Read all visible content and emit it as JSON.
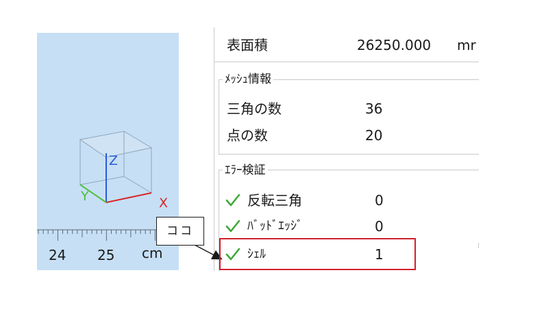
{
  "viewport": {
    "axes": {
      "x": "X",
      "y": "Y",
      "z": "Z"
    },
    "ruler": {
      "labels": [
        "24",
        "25"
      ],
      "unit": "cm"
    },
    "colors": {
      "background": "#c6dff5",
      "x_axis": "#d8262a",
      "y_axis": "#4fbf3d",
      "z_axis": "#2a5bd6"
    }
  },
  "properties": {
    "surface_area": {
      "label": "表面積",
      "value": "26250.000",
      "unit": "mr"
    },
    "mesh_info": {
      "title": "ﾒｯｼｭ情報",
      "triangles": {
        "label": "三角の数",
        "value": "36"
      },
      "points": {
        "label": "点の数",
        "value": "20"
      }
    },
    "error_check": {
      "title": "ｴﾗｰ検証",
      "items": [
        {
          "label": "反転三角",
          "value": "0",
          "icon": "check-icon"
        },
        {
          "label": "ﾊﾞｯﾄﾞｴｯｼﾞ",
          "value": "0",
          "icon": "check-icon"
        },
        {
          "label": "ｼｪﾙ",
          "value": "1",
          "icon": "check-icon"
        }
      ]
    }
  },
  "annotation": {
    "callout": "ココ",
    "highlight_color": "#d01f2b"
  },
  "colors": {
    "check": "#3fa83a",
    "border": "#c9c9c9"
  }
}
